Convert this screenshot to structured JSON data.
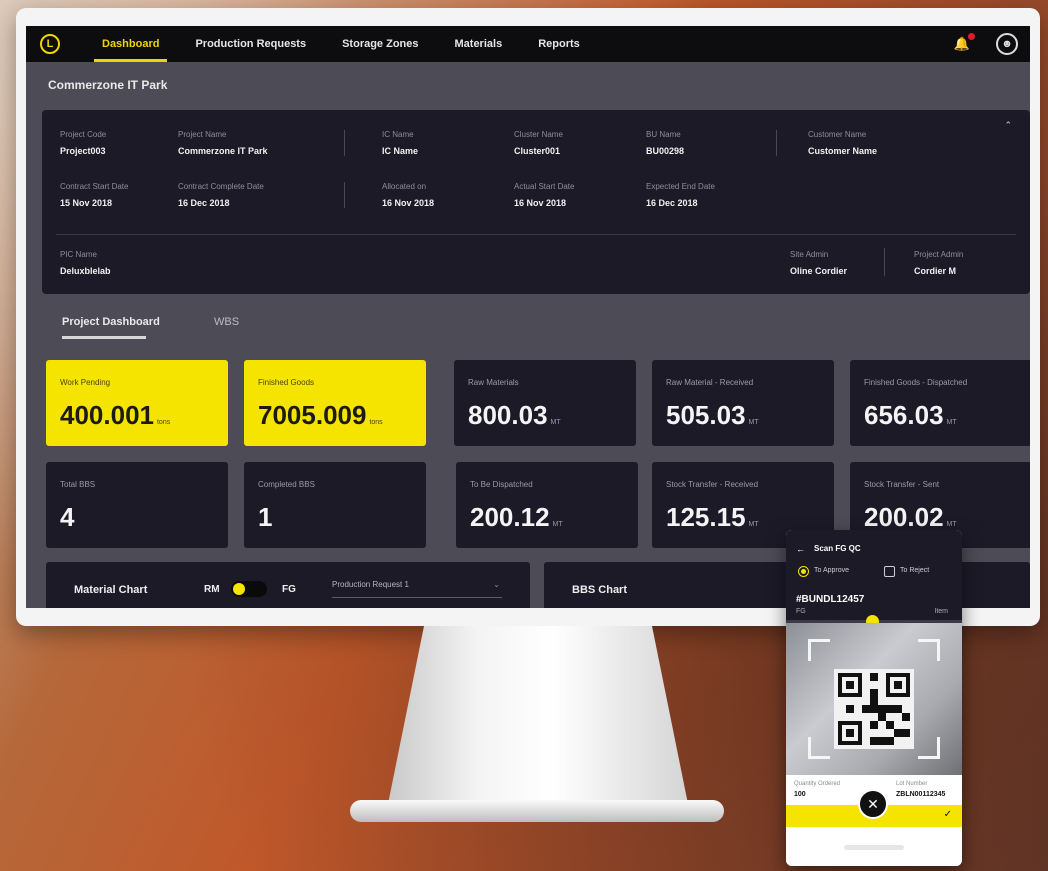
{
  "nav": {
    "logo": "L",
    "items": [
      "Dashboard",
      "Production Requests",
      "Storage Zones",
      "Materials",
      "Reports"
    ]
  },
  "page": {
    "title": "Commerzone IT Park"
  },
  "project": {
    "row1": [
      {
        "label": "Project Code",
        "value": "Project003"
      },
      {
        "label": "Project Name",
        "value": "Commerzone IT Park"
      },
      {
        "label": "IC Name",
        "value": "IC Name"
      },
      {
        "label": "Cluster Name",
        "value": "Cluster001"
      },
      {
        "label": "BU Name",
        "value": "BU00298"
      },
      {
        "label": "Customer Name",
        "value": "Customer Name"
      }
    ],
    "row2": [
      {
        "label": "Contract Start Date",
        "value": "15 Nov 2018"
      },
      {
        "label": "Contract Complete Date",
        "value": "16 Dec 2018"
      },
      {
        "label": "Allocated on",
        "value": "16 Nov 2018"
      },
      {
        "label": "Actual Start Date",
        "value": "16 Nov 2018"
      },
      {
        "label": "Expected End Date",
        "value": "16 Dec 2018"
      }
    ],
    "row3": [
      {
        "label": "PIC Name",
        "value": "Deluxblelab"
      },
      {
        "label": "Site Admin",
        "value": "Oline Cordier"
      },
      {
        "label": "Project Admin",
        "value": "Cordier M"
      }
    ]
  },
  "tabs": [
    "Project Dashboard",
    "WBS"
  ],
  "cards_row1": [
    {
      "label": "Work Pending",
      "value": "400.001",
      "unit": "tons"
    },
    {
      "label": "Finished Goods",
      "value": "7005.009",
      "unit": "tons"
    },
    {
      "label": "Raw Materials",
      "value": "800.03",
      "unit": "MT"
    },
    {
      "label": "Raw Material - Received",
      "value": "505.03",
      "unit": "MT"
    },
    {
      "label": "Finished Goods - Dispatched",
      "value": "656.03",
      "unit": "MT"
    }
  ],
  "cards_row2": [
    {
      "label": "Total BBS",
      "value": "4",
      "unit": ""
    },
    {
      "label": "Completed BBS",
      "value": "1",
      "unit": ""
    },
    {
      "label": "To Be Dispatched",
      "value": "200.12",
      "unit": "MT"
    },
    {
      "label": "Stock Transfer - Received",
      "value": "125.15",
      "unit": "MT"
    },
    {
      "label": "Stock Transfer - Sent",
      "value": "200.02",
      "unit": "MT"
    }
  ],
  "material_chart": {
    "title": "Material Chart",
    "toggle_left": "RM",
    "toggle_right": "FG",
    "select_value": "Production Request 1"
  },
  "bbs_chart": {
    "title": "BBS Chart"
  },
  "phone": {
    "title": "Scan FG QC",
    "option1": "To Approve",
    "option2": "To Reject",
    "code": "#BUNDL12457",
    "sub": "FG",
    "meta": "Item",
    "foot_label_left": "Quantity Ordered",
    "foot_value_left": "100",
    "foot_label_right": "Lot Number",
    "foot_value_right": "ZBLN00112345"
  }
}
